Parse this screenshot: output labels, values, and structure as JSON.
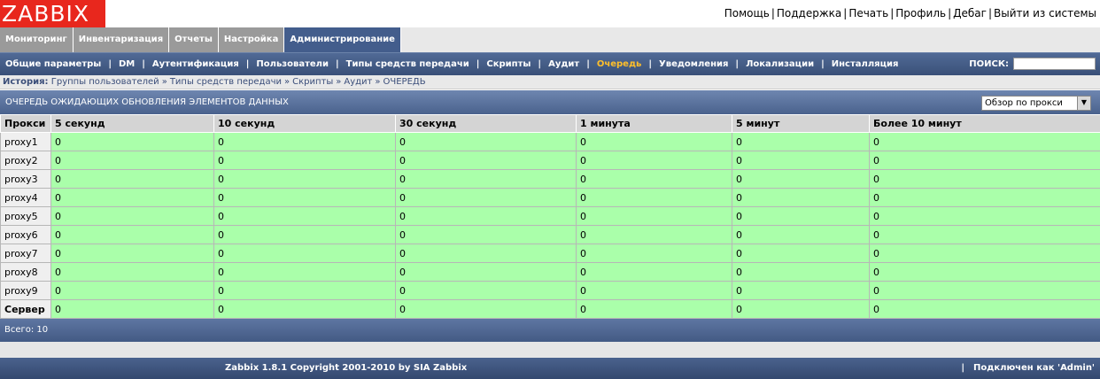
{
  "logo": "ZABBIX",
  "toplinks": [
    "Помощь",
    "Поддержка",
    "Печать",
    "Профиль",
    "Дебаг",
    "Выйти из системы"
  ],
  "tabs": [
    {
      "label": "Мониторинг",
      "active": false
    },
    {
      "label": "Инвентаризация",
      "active": false
    },
    {
      "label": "Отчеты",
      "active": false
    },
    {
      "label": "Настройка",
      "active": false
    },
    {
      "label": "Администрирование",
      "active": true
    }
  ],
  "submenu": {
    "items": [
      {
        "label": "Общие параметры"
      },
      {
        "label": "DM"
      },
      {
        "label": "Аутентификация"
      },
      {
        "label": "Пользователи"
      },
      {
        "label": "Типы средств передачи"
      },
      {
        "label": "Скрипты"
      },
      {
        "label": "Аудит"
      },
      {
        "label": "Очередь",
        "active": true
      },
      {
        "label": "Уведомления"
      },
      {
        "label": "Локализации"
      },
      {
        "label": "Инсталляция"
      }
    ],
    "search_label": "ПОИСК:",
    "search_value": ""
  },
  "history": {
    "label": "История:",
    "items": [
      "Группы пользователей",
      "Типы средств передачи",
      "Скрипты",
      "Аудит",
      "ОЧЕРЕДЬ"
    ]
  },
  "title": "ОЧЕРЕДЬ ОЖИДАЮЩИХ ОБНОВЛЕНИЯ ЭЛЕМЕНТОВ ДАННЫХ",
  "view_select": "Обзор по прокси",
  "table": {
    "headers": [
      "Прокси",
      "5 секунд",
      "10 секунд",
      "30 секунд",
      "1 минута",
      "5 минут",
      "Более 10 минут"
    ],
    "rows": [
      {
        "name": "proxy1",
        "values": [
          "0",
          "0",
          "0",
          "0",
          "0",
          "0"
        ]
      },
      {
        "name": "proxy2",
        "values": [
          "0",
          "0",
          "0",
          "0",
          "0",
          "0"
        ]
      },
      {
        "name": "proxy3",
        "values": [
          "0",
          "0",
          "0",
          "0",
          "0",
          "0"
        ]
      },
      {
        "name": "proxy4",
        "values": [
          "0",
          "0",
          "0",
          "0",
          "0",
          "0"
        ]
      },
      {
        "name": "proxy5",
        "values": [
          "0",
          "0",
          "0",
          "0",
          "0",
          "0"
        ]
      },
      {
        "name": "proxy6",
        "values": [
          "0",
          "0",
          "0",
          "0",
          "0",
          "0"
        ]
      },
      {
        "name": "proxy7",
        "values": [
          "0",
          "0",
          "0",
          "0",
          "0",
          "0"
        ]
      },
      {
        "name": "proxy8",
        "values": [
          "0",
          "0",
          "0",
          "0",
          "0",
          "0"
        ]
      },
      {
        "name": "proxy9",
        "values": [
          "0",
          "0",
          "0",
          "0",
          "0",
          "0"
        ]
      },
      {
        "name": "Сервер",
        "values": [
          "0",
          "0",
          "0",
          "0",
          "0",
          "0"
        ],
        "bold": true
      }
    ]
  },
  "total": "Всего: 10",
  "footer": {
    "copyright": "Zabbix 1.8.1 Copyright 2001-2010 by SIA Zabbix",
    "connected": "Подключен как 'Admin'"
  },
  "colors": {
    "logo_bg": "#e8271d",
    "cell_ok": "#aaffaa",
    "active_menu": "#ffbf2a",
    "nav_blue": "#44597f"
  }
}
